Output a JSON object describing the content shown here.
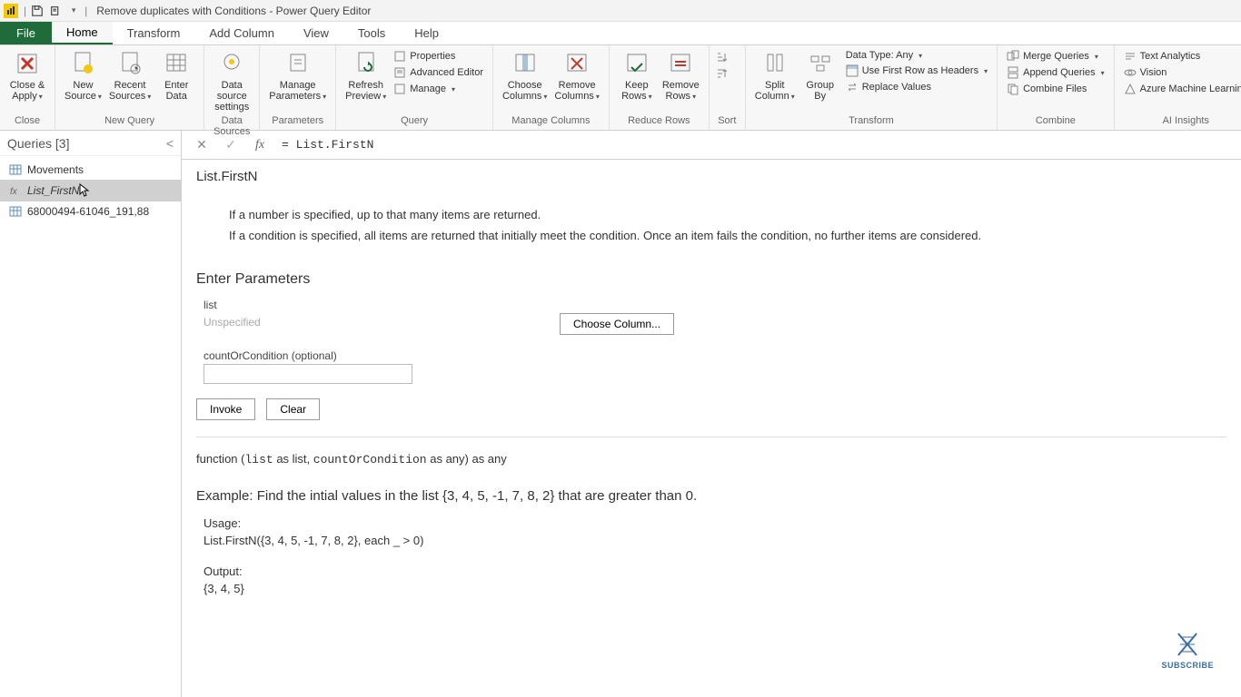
{
  "title": "Remove duplicates with Conditions - Power Query Editor",
  "tabs": {
    "file": "File",
    "home": "Home",
    "transform": "Transform",
    "addcolumn": "Add Column",
    "view": "View",
    "tools": "Tools",
    "help": "Help"
  },
  "ribbon": {
    "close_apply": "Close &\nApply",
    "close_group": "Close",
    "new_source": "New\nSource",
    "recent_sources": "Recent\nSources",
    "enter_data": "Enter\nData",
    "newquery_group": "New Query",
    "data_source_settings": "Data source\nsettings",
    "datasources_group": "Data Sources",
    "manage_parameters": "Manage\nParameters",
    "parameters_group": "Parameters",
    "refresh_preview": "Refresh\nPreview",
    "properties": "Properties",
    "advanced_editor": "Advanced Editor",
    "manage": "Manage",
    "query_group": "Query",
    "choose_columns": "Choose\nColumns",
    "remove_columns": "Remove\nColumns",
    "managecolumns_group": "Manage Columns",
    "keep_rows": "Keep\nRows",
    "remove_rows": "Remove\nRows",
    "reducerows_group": "Reduce Rows",
    "sort_group": "Sort",
    "split_column": "Split\nColumn",
    "group_by": "Group\nBy",
    "data_type": "Data Type: Any",
    "first_row_headers": "Use First Row as Headers",
    "replace_values": "Replace Values",
    "transform_group": "Transform",
    "merge_queries": "Merge Queries",
    "append_queries": "Append Queries",
    "combine_files": "Combine Files",
    "combine_group": "Combine",
    "text_analytics": "Text Analytics",
    "vision": "Vision",
    "azure_ml": "Azure Machine Learning",
    "ai_group": "AI Insights"
  },
  "queries": {
    "header": "Queries [3]",
    "items": [
      {
        "label": "Movements"
      },
      {
        "label": "List_FirstN"
      },
      {
        "label": "68000494-61046_191,88"
      }
    ]
  },
  "formula": "= List.FirstN",
  "doc": {
    "title": "List.FirstN",
    "desc1": "If a number is specified, up to that many items are returned.",
    "desc2": "If a condition is specified, all items are returned that initially meet the condition. Once an item fails the condition, no further items are considered.",
    "enter_params": "Enter Parameters",
    "param_list": "list",
    "param_list_hint": "Unspecified",
    "choose_column": "Choose Column...",
    "param_count": "countOrCondition (optional)",
    "invoke": "Invoke",
    "clear": "Clear",
    "sig_prefix": "function (",
    "sig_list": "list",
    "sig_as_list": " as list, ",
    "sig_count": "countOrCondition",
    "sig_suffix": " as any) as any",
    "example_h": "Example: Find the intial values in the list {3, 4, 5, -1, 7, 8, 2} that are greater than 0.",
    "usage_label": "Usage:",
    "usage_code": "List.FirstN({3, 4, 5, -1, 7, 8, 2}, each _ > 0)",
    "output_label": "Output:",
    "output_code": "{3, 4, 5}"
  },
  "subscribe": "SUBSCRIBE"
}
